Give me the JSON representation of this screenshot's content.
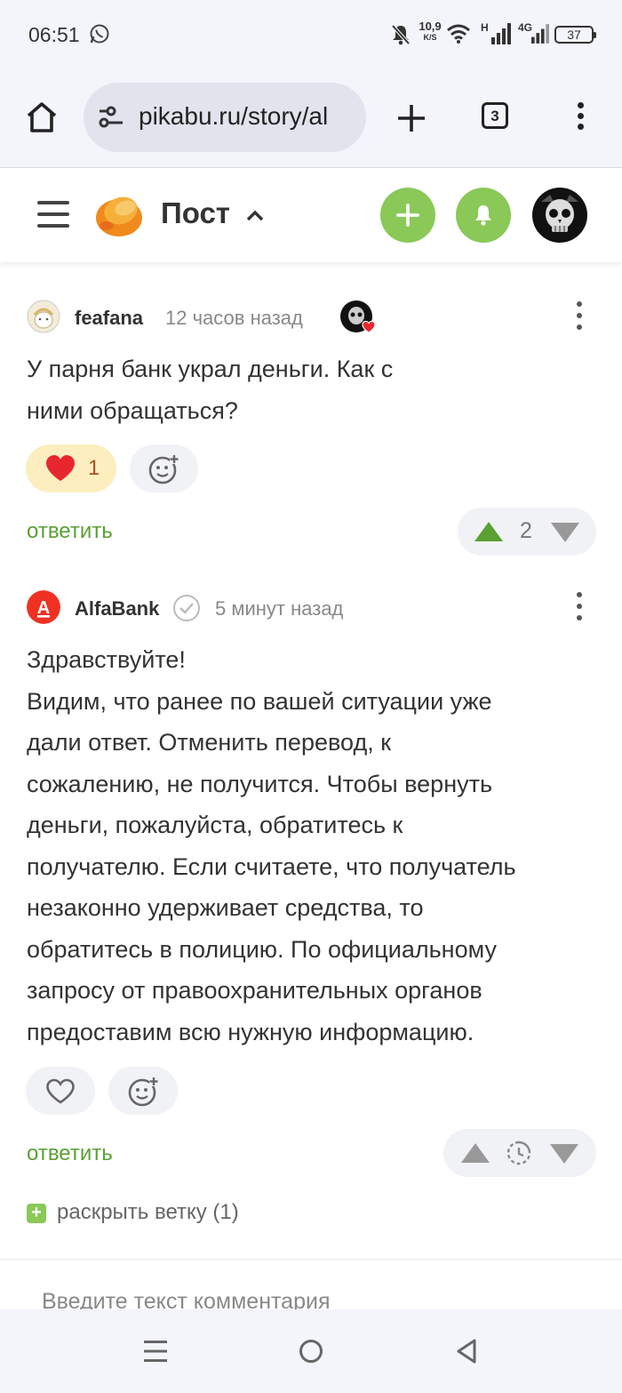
{
  "status_bar": {
    "time": "06:51",
    "net_speed_value": "10,9",
    "net_speed_unit": "K/S",
    "network_1": "H",
    "network_2": "4G",
    "battery": "37"
  },
  "browser": {
    "url": "pikabu.ru/story/al",
    "tabs_count": "3"
  },
  "header": {
    "title": "Пост"
  },
  "comments": [
    {
      "author": "feafana",
      "time": "12 часов назад",
      "text_lines": [
        "У парня банк украл деньги. Как с",
        "ними обращаться?"
      ],
      "reaction_count": "1",
      "reply": "ответить",
      "rating": "2"
    },
    {
      "author": "AlfaBank",
      "avatar_letter": "А",
      "time": "5 минут назад",
      "text_lines": [
        "Здравствуйте!",
        "Видим, что ранее по вашей ситуации уже",
        "дали ответ. Отменить перевод, к",
        "сожалению, не получится. Чтобы вернуть",
        "деньги, пожалуйста, обратитесь к",
        "получателю. Если считаете, что получатель",
        "незаконно удерживает средства, то",
        "обратитесь в полицию. По официальному",
        "запросу от правоохранительных органов",
        "предоставим всю нужную информацию."
      ],
      "reply": "ответить"
    }
  ],
  "expand_thread": "раскрыть ветку (1)",
  "comment_input": {
    "placeholder": "Введите текст комментария"
  },
  "colors": {
    "accent_green": "#8ac858",
    "link_green": "#5aa033",
    "heart_red": "#e8262d",
    "alfa_red": "#ef3124"
  },
  "icons": [
    "whatsapp-icon",
    "mute-icon",
    "wifi-icon",
    "signal-icon",
    "home-icon",
    "site-settings-icon",
    "plus-icon",
    "more-icon",
    "menu-icon",
    "pikabu-logo",
    "chevron-up-icon",
    "bell-icon",
    "heart-icon",
    "add-reaction-icon",
    "arrow-up-icon",
    "arrow-down-icon",
    "verified-icon",
    "pending-icon"
  ]
}
